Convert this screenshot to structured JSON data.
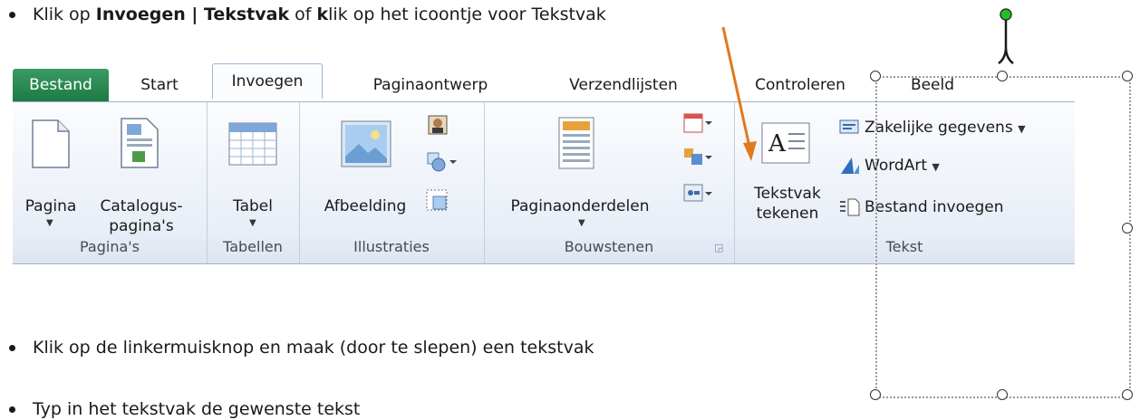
{
  "instructions": {
    "step1": {
      "prefix": "Klik op ",
      "bold1": "Invoegen | Tekstvak",
      "middle": " of ",
      "bold2": "k",
      "suffix": "lik op het icoontje voor Tekstvak"
    },
    "step2": "Klik op de linkermuisknop en maak (door te slepen) een tekstvak",
    "step3": "Typ in het tekstvak de gewenste tekst"
  },
  "ribbon": {
    "tabs": [
      "Bestand",
      "Start",
      "Invoegen",
      "Paginaontwerp",
      "Verzendlijsten",
      "Controleren",
      "Beeld"
    ],
    "active_tab": "Invoegen",
    "groups": {
      "paginas": {
        "label": "Pagina's",
        "pagina": "Pagina",
        "catalogus_line1": "Catalogus-",
        "catalogus_line2": "pagina's"
      },
      "tabellen": {
        "label": "Tabellen",
        "tabel": "Tabel"
      },
      "illustraties": {
        "label": "Illustraties",
        "afbeelding": "Afbeelding"
      },
      "bouwstenen": {
        "label": "Bouwstenen",
        "paginaonderdelen": "Paginaonderdelen"
      },
      "tekst": {
        "label": "Tekst",
        "tekstvak_line1": "Tekstvak",
        "tekstvak_line2": "tekenen",
        "zakelijke": "Zakelijke gegevens",
        "wordart": "WordArt",
        "bestand_invoegen": "Bestand invoegen"
      }
    }
  },
  "colors": {
    "file_tab": "#1e7a45",
    "arrow": "#e07a1f",
    "rotate_handle": "#22c022"
  }
}
